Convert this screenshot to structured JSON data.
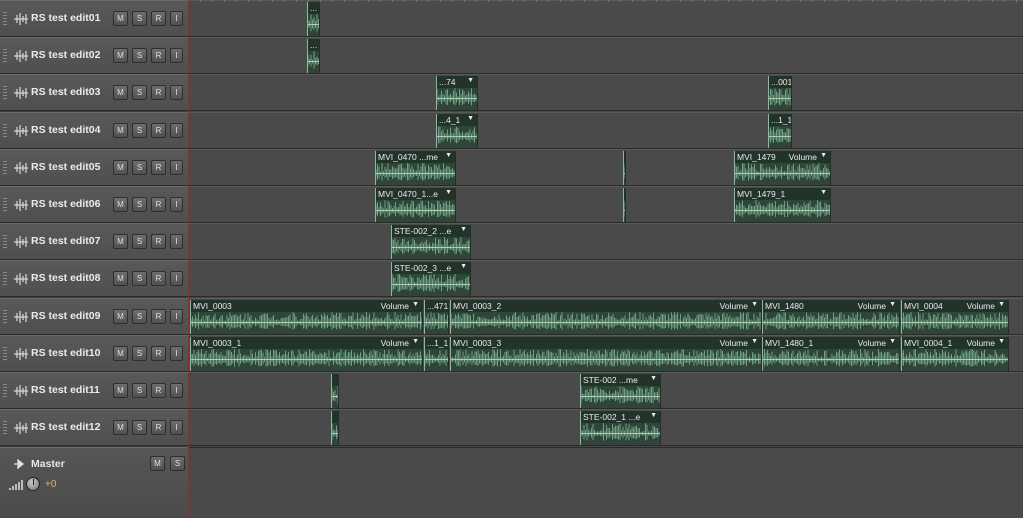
{
  "button_labels": {
    "mute": "M",
    "solo": "S",
    "record": "R",
    "input": "I"
  },
  "tracks": [
    {
      "name": "RS test edit01",
      "clips": [
        {
          "label": "...",
          "vol": ""
        }
      ]
    },
    {
      "name": "RS test edit02",
      "clips": [
        {
          "label": "...",
          "vol": ""
        }
      ]
    },
    {
      "name": "RS test edit03",
      "clips": [
        {
          "label": "...74",
          "vol": ""
        },
        {
          "label": "...001",
          "vol": ""
        }
      ]
    },
    {
      "name": "RS test edit04",
      "clips": [
        {
          "label": "...4_1",
          "vol": ""
        },
        {
          "label": "...1_1",
          "vol": ""
        }
      ]
    },
    {
      "name": "RS test edit05",
      "clips": [
        {
          "label": "MVI_0470 ...me",
          "vol": ""
        },
        {
          "label": "",
          "vol": ""
        },
        {
          "label": "MVI_1479",
          "vol": "Volume"
        }
      ]
    },
    {
      "name": "RS test edit06",
      "clips": [
        {
          "label": "MVI_0470_1...e",
          "vol": ""
        },
        {
          "label": "",
          "vol": ""
        },
        {
          "label": "MVI_1479_1",
          "vol": ""
        }
      ]
    },
    {
      "name": "RS test edit07",
      "clips": [
        {
          "label": "STE-002_2   ...e",
          "vol": ""
        }
      ]
    },
    {
      "name": "RS test edit08",
      "clips": [
        {
          "label": "STE-002_3   ...e",
          "vol": ""
        }
      ]
    },
    {
      "name": "RS test edit09",
      "clips": [
        {
          "label": "MVI_0003",
          "vol": "Volume"
        },
        {
          "label": "...471",
          "vol": ""
        },
        {
          "label": "MVI_0003_2",
          "vol": "Volume"
        },
        {
          "label": "MVI_1480",
          "vol": "Volume"
        },
        {
          "label": "MVI_0004",
          "vol": "Volume"
        }
      ]
    },
    {
      "name": "RS test edit10",
      "clips": [
        {
          "label": "MVI_0003_1",
          "vol": "Volume"
        },
        {
          "label": "...1_1",
          "vol": ""
        },
        {
          "label": "MVI_0003_3",
          "vol": "Volume"
        },
        {
          "label": "MVI_1480_1",
          "vol": "Volume"
        },
        {
          "label": "MVI_0004_1",
          "vol": "Volume"
        }
      ]
    },
    {
      "name": "RS test edit11",
      "clips": [
        {
          "label": "",
          "vol": ""
        },
        {
          "label": "STE-002   ...me",
          "vol": ""
        }
      ]
    },
    {
      "name": "RS test edit12",
      "clips": [
        {
          "label": "",
          "vol": ""
        },
        {
          "label": "STE-002_1   ...e",
          "vol": ""
        }
      ]
    }
  ],
  "master": {
    "name": "Master",
    "mute": "M",
    "solo": "S",
    "volume": "+0"
  },
  "colors": {
    "clip": "#2f4538",
    "waveform": "#7fb896",
    "playhead": "#b02020",
    "volume_value": "#d8b860"
  }
}
